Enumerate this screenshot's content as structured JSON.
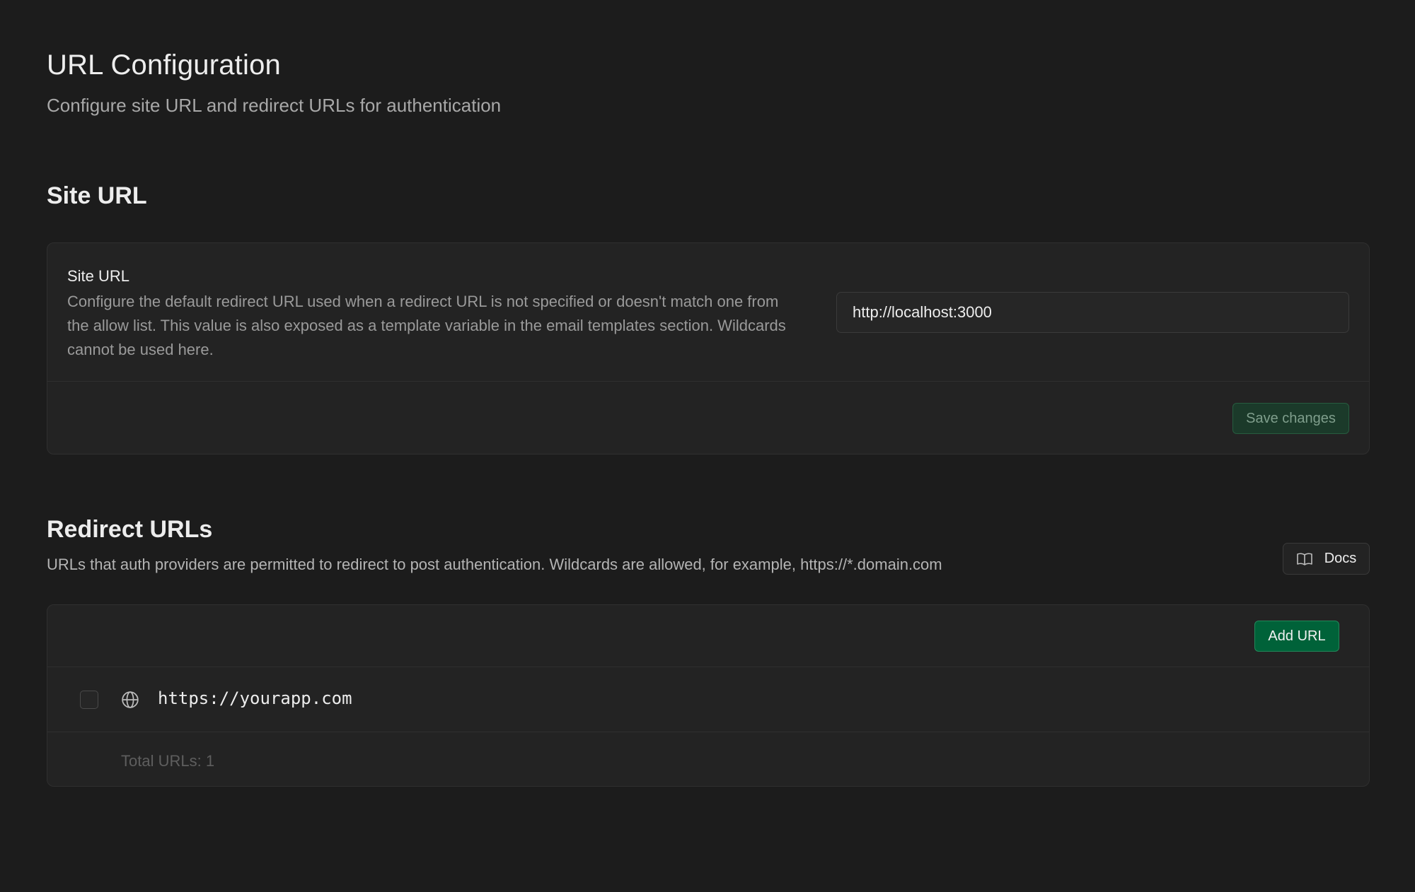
{
  "header": {
    "title": "URL Configuration",
    "subtitle": "Configure site URL and redirect URLs for authentication"
  },
  "site_url_section": {
    "title": "Site URL",
    "field_label": "Site URL",
    "field_description": "Configure the default redirect URL used when a redirect URL is not specified or doesn't match one from the allow list. This value is also exposed as a template variable in the email templates section. Wildcards cannot be used here.",
    "input_value": "http://localhost:3000",
    "save_label": "Save changes"
  },
  "redirect_section": {
    "title": "Redirect URLs",
    "description": "URLs that auth providers are permitted to redirect to post authentication. Wildcards are allowed, for example, https://*.domain.com",
    "docs_label": "Docs",
    "docs_icon": "book-icon",
    "add_label": "Add URL",
    "urls": [
      {
        "url": "https://yourapp.com",
        "icon": "globe-icon",
        "checked": false
      }
    ],
    "total_label": "Total URLs: 1"
  },
  "colors": {
    "background": "#1c1c1c",
    "panel": "#232323",
    "accent_green": "#006239",
    "muted_text": "#9a9a9a"
  }
}
